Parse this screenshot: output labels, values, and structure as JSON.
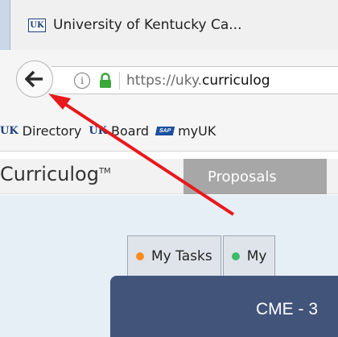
{
  "tab": {
    "favicon_text": "UK",
    "title": "University of Kentucky Ca..."
  },
  "nav": {
    "back_icon": "back-arrow-icon",
    "info_icon_text": "i",
    "url_prefix": "https://uky.",
    "url_domain": "curriculog"
  },
  "bookmarks": [
    {
      "icon": "UK",
      "label": "Directory"
    },
    {
      "icon": "UK",
      "label": "Board"
    },
    {
      "icon": "SAP",
      "label": "myUK"
    }
  ],
  "app": {
    "brand": "Curriculog",
    "brand_mark": "TM",
    "menu_proposals": "Proposals"
  },
  "tasks": {
    "tab1_label": "My Tasks",
    "tab1_dot_color": "#ff8c1a",
    "tab2_label": "My",
    "tab2_dot_color": "#3dbb6a",
    "panel_title": "CME - 3"
  },
  "colors": {
    "annotation_arrow": "#e8181c",
    "panel_bg": "#42547a",
    "lock_green": "#3aa83a"
  }
}
